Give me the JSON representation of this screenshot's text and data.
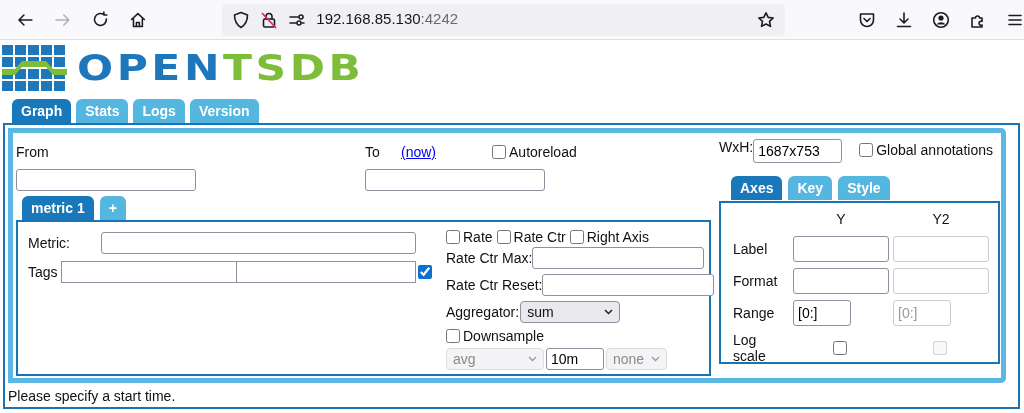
{
  "browser": {
    "url_host": "192.168.85.130",
    "url_port": ":4242"
  },
  "logo": {
    "part_1": "OPEN",
    "part_2": "TSDB"
  },
  "tabs": [
    {
      "label": "Graph",
      "selected": true
    },
    {
      "label": "Stats",
      "selected": false
    },
    {
      "label": "Logs",
      "selected": false
    },
    {
      "label": "Version",
      "selected": false
    }
  ],
  "query": {
    "from_label": "From",
    "to_label": "To",
    "now_link": "(now)",
    "autoreload": {
      "label": "Autoreload",
      "checked": false
    },
    "wxh_label": "WxH:",
    "wxh_value": "1687x753",
    "global_annotations": {
      "label": "Global annotations",
      "checked": false
    }
  },
  "metric_tabs": [
    {
      "label": "metric 1",
      "selected": true
    },
    {
      "label": "+",
      "selected": false
    }
  ],
  "metric": {
    "metric_label": "Metric:",
    "tags_label": "Tags",
    "tag_checkbox_checked": true,
    "flags": [
      {
        "label": "Rate",
        "checked": false
      },
      {
        "label": "Rate Ctr",
        "checked": false
      },
      {
        "label": "Right Axis",
        "checked": false
      }
    ],
    "rate_ctr_max_label": "Rate Ctr Max:",
    "rate_ctr_reset_label": "Rate Ctr Reset:",
    "aggregator_label": "Aggregator:",
    "aggregator_value": "sum",
    "downsample": {
      "label": "Downsample",
      "checked": false,
      "disabled": true,
      "function": "avg",
      "interval": "10m",
      "fill": "none"
    }
  },
  "axes_tabs": [
    {
      "label": "Axes",
      "selected": true
    },
    {
      "label": "Key",
      "selected": false
    },
    {
      "label": "Style",
      "selected": false
    }
  ],
  "axes": {
    "columns": [
      "Y",
      "Y2"
    ],
    "y2_disabled": true,
    "rows": [
      {
        "label": "Label",
        "kind": "field"
      },
      {
        "label": "Format",
        "kind": "field"
      },
      {
        "label": "Range",
        "kind": "short_field",
        "y_value": "[0:]",
        "y2_value": "[0:]"
      },
      {
        "label": "Log scale",
        "kind": "checkbox",
        "y_checked": false,
        "y2_checked": false
      }
    ]
  },
  "status": "Please specify a start time."
}
